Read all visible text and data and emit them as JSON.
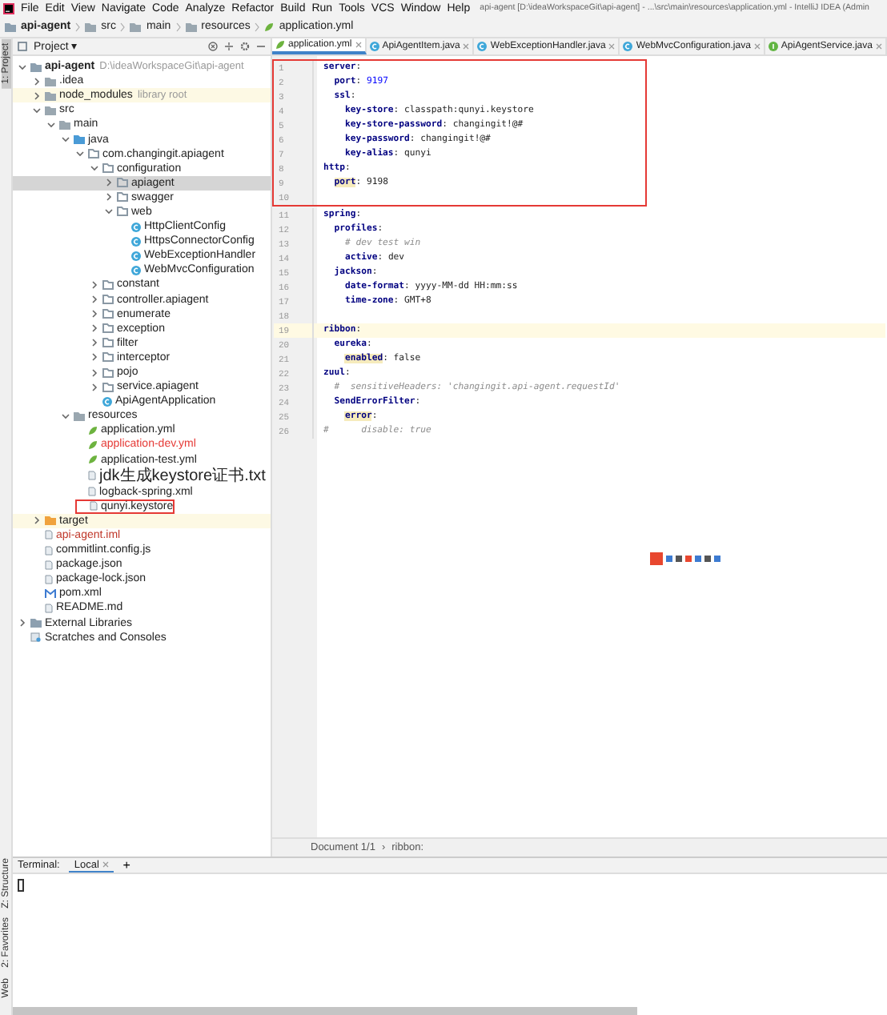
{
  "menu": {
    "items": [
      "File",
      "Edit",
      "View",
      "Navigate",
      "Code",
      "Analyze",
      "Refactor",
      "Build",
      "Run",
      "Tools",
      "VCS",
      "Window",
      "Help"
    ],
    "title": "api-agent [D:\\ideaWorkspaceGit\\api-agent] - ...\\src\\main\\resources\\application.yml - IntelliJ IDEA (Admin"
  },
  "breadcrumbs": [
    {
      "label": "api-agent",
      "kind": "module"
    },
    {
      "label": "src",
      "kind": "folder"
    },
    {
      "label": "main",
      "kind": "folder"
    },
    {
      "label": "resources",
      "kind": "folder"
    },
    {
      "label": "application.yml",
      "kind": "yml"
    }
  ],
  "side_tabs_top": [
    {
      "label": "1: Project",
      "selected": true
    }
  ],
  "side_tabs_bottom": [
    {
      "label": "Z: Structure",
      "selected": false
    },
    {
      "label": "2: Favorites",
      "selected": false
    },
    {
      "label": "Web",
      "selected": false
    }
  ],
  "project_panel": {
    "title": "Project ▾",
    "tree": [
      {
        "label": "api-agent",
        "kind": "module",
        "hint": "D:\\ideaWorkspaceGit\\api-agent",
        "expanded": true,
        "selected": false,
        "children": [
          {
            "label": ".idea",
            "kind": "folder",
            "expanded": false,
            "selected": false
          },
          {
            "label": "node_modules",
            "kind": "folder",
            "hint": "library root",
            "expanded": false,
            "selected": false,
            "shaded": true
          },
          {
            "label": "src",
            "kind": "folder",
            "expanded": true,
            "selected": false,
            "children": [
              {
                "label": "main",
                "kind": "folder",
                "expanded": true,
                "selected": false,
                "children": [
                  {
                    "label": "java",
                    "kind": "source-folder",
                    "expanded": true,
                    "selected": false,
                    "children": [
                      {
                        "label": "com.changingit.apiagent",
                        "kind": "package",
                        "expanded": true,
                        "selected": false,
                        "children": [
                          {
                            "label": "configuration",
                            "kind": "package",
                            "expanded": true,
                            "selected": false,
                            "children": [
                              {
                                "label": "apiagent",
                                "kind": "package",
                                "expanded": false,
                                "selected": true
                              },
                              {
                                "label": "swagger",
                                "kind": "package",
                                "expanded": false,
                                "selected": false
                              },
                              {
                                "label": "web",
                                "kind": "package",
                                "expanded": true,
                                "selected": false,
                                "children": [
                                  {
                                    "label": "HttpClientConfig",
                                    "kind": "class",
                                    "selected": false
                                  },
                                  {
                                    "label": "HttpsConnectorConfig",
                                    "kind": "class",
                                    "selected": false
                                  },
                                  {
                                    "label": "WebExceptionHandler",
                                    "kind": "class",
                                    "selected": false
                                  },
                                  {
                                    "label": "WebMvcConfiguration",
                                    "kind": "class",
                                    "selected": false
                                  }
                                ]
                              }
                            ]
                          },
                          {
                            "label": "constant",
                            "kind": "package",
                            "expanded": false,
                            "selected": false
                          },
                          {
                            "label": "controller.apiagent",
                            "kind": "package",
                            "expanded": false,
                            "selected": false
                          },
                          {
                            "label": "enumerate",
                            "kind": "package",
                            "expanded": false,
                            "selected": false
                          },
                          {
                            "label": "exception",
                            "kind": "package",
                            "expanded": false,
                            "selected": false
                          },
                          {
                            "label": "filter",
                            "kind": "package",
                            "expanded": false,
                            "selected": false
                          },
                          {
                            "label": "interceptor",
                            "kind": "package",
                            "expanded": false,
                            "selected": false
                          },
                          {
                            "label": "pojo",
                            "kind": "package",
                            "expanded": false,
                            "selected": false
                          },
                          {
                            "label": "service.apiagent",
                            "kind": "package",
                            "expanded": false,
                            "selected": false
                          },
                          {
                            "label": "ApiAgentApplication",
                            "kind": "spring-class",
                            "selected": false
                          }
                        ]
                      }
                    ]
                  },
                  {
                    "label": "resources",
                    "kind": "resources-folder",
                    "expanded": true,
                    "selected": false,
                    "children": [
                      {
                        "label": "application.yml",
                        "kind": "yml",
                        "selected": false
                      },
                      {
                        "label": "application-dev.yml",
                        "kind": "yml",
                        "selected": false,
                        "color": "#e53935"
                      },
                      {
                        "label": "application-test.yml",
                        "kind": "yml",
                        "selected": false
                      },
                      {
                        "label": "jdk生成keystore证书.txt",
                        "kind": "text-file",
                        "selected": false
                      },
                      {
                        "label": "logback-spring.xml",
                        "kind": "xml",
                        "selected": false
                      },
                      {
                        "label": "qunyi.keystore",
                        "kind": "keystore",
                        "selected": false,
                        "annotated": true
                      }
                    ]
                  }
                ]
              }
            ]
          },
          {
            "label": "target",
            "kind": "excluded-folder",
            "expanded": false,
            "selected": false,
            "shaded": true
          },
          {
            "label": "api-agent.iml",
            "kind": "iml",
            "selected": false,
            "color": "#c0392b"
          },
          {
            "label": "commitlint.config.js",
            "kind": "js",
            "selected": false
          },
          {
            "label": "package.json",
            "kind": "json",
            "selected": false
          },
          {
            "label": "package-lock.json",
            "kind": "json",
            "selected": false
          },
          {
            "label": "pom.xml",
            "kind": "maven",
            "selected": false
          },
          {
            "label": "README.md",
            "kind": "markdown",
            "selected": false
          }
        ]
      },
      {
        "label": "External Libraries",
        "kind": "libraries",
        "expanded": false,
        "selected": false
      },
      {
        "label": "Scratches and Consoles",
        "kind": "scratches",
        "selected": false
      }
    ]
  },
  "editor": {
    "tabs": [
      {
        "label": "application.yml",
        "kind": "yml",
        "selected": true
      },
      {
        "label": "ApiAgentItem.java",
        "kind": "class",
        "selected": false
      },
      {
        "label": "WebExceptionHandler.java",
        "kind": "class",
        "selected": false
      },
      {
        "label": "WebMvcConfiguration.java",
        "kind": "class",
        "selected": false
      },
      {
        "label": "ApiAgentService.java",
        "kind": "interface",
        "selected": false
      }
    ],
    "code_blocks": [
      {
        "annotated": true,
        "lines": [
          {
            "number": "1",
            "segments": [
              {
                "kind": "key",
                "text": "server"
              },
              {
                "kind": "plain",
                "text": ":"
              }
            ]
          },
          {
            "number": "2",
            "segments": [
              {
                "kind": "key",
                "text": "  port"
              },
              {
                "kind": "plain",
                "text": ": "
              },
              {
                "kind": "number",
                "text": "9197"
              }
            ]
          },
          {
            "number": "3",
            "segments": [
              {
                "kind": "key",
                "text": "  ssl"
              },
              {
                "kind": "plain",
                "text": ":"
              }
            ]
          },
          {
            "number": "4",
            "segments": [
              {
                "kind": "key",
                "text": "    key-store"
              },
              {
                "kind": "plain",
                "text": ": classpath:qunyi.keystore"
              }
            ]
          },
          {
            "number": "5",
            "segments": [
              {
                "kind": "key",
                "text": "    key-store-password"
              },
              {
                "kind": "plain",
                "text": ": changingit!@#"
              }
            ]
          },
          {
            "number": "6",
            "segments": [
              {
                "kind": "key",
                "text": "    key-password"
              },
              {
                "kind": "plain",
                "text": ": changingit!@#"
              }
            ]
          },
          {
            "number": "7",
            "segments": [
              {
                "kind": "key",
                "text": "    key-alias"
              },
              {
                "kind": "plain",
                "text": ": qunyi"
              }
            ]
          },
          {
            "number": "8",
            "segments": [
              {
                "kind": "key",
                "text": "http"
              },
              {
                "kind": "plain",
                "text": ":"
              }
            ]
          },
          {
            "number": "9",
            "segments": [
              {
                "kind": "marked-key",
                "text": "  port"
              },
              {
                "kind": "plain",
                "text": ": 9198"
              }
            ]
          },
          {
            "number": "10"
          }
        ]
      },
      {
        "annotated": false,
        "lines": [
          {
            "number": "11",
            "segments": [
              {
                "kind": "key",
                "text": "spring"
              },
              {
                "kind": "plain",
                "text": ":"
              }
            ]
          },
          {
            "number": "12",
            "segments": [
              {
                "kind": "key",
                "text": "  profiles"
              },
              {
                "kind": "plain",
                "text": ":"
              }
            ]
          },
          {
            "number": "13",
            "segments": [
              {
                "kind": "comment",
                "text": "    # dev test win"
              }
            ]
          },
          {
            "number": "14",
            "segments": [
              {
                "kind": "key",
                "text": "    active"
              },
              {
                "kind": "plain",
                "text": ": dev"
              }
            ]
          },
          {
            "number": "15",
            "segments": [
              {
                "kind": "key",
                "text": "  jackson"
              },
              {
                "kind": "plain",
                "text": ":"
              }
            ]
          },
          {
            "number": "16",
            "segments": [
              {
                "kind": "key",
                "text": "    date-format"
              },
              {
                "kind": "plain",
                "text": ": yyyy-MM-dd HH:mm:ss"
              }
            ]
          },
          {
            "number": "17",
            "segments": [
              {
                "kind": "key",
                "text": "    time-zone"
              },
              {
                "kind": "plain",
                "text": ": GMT+8"
              }
            ]
          },
          {
            "number": "18"
          },
          {
            "number": "19",
            "current": true,
            "segments": [
              {
                "kind": "key",
                "text": "ribbon"
              },
              {
                "kind": "plain",
                "text": ":"
              }
            ]
          },
          {
            "number": "20",
            "segments": [
              {
                "kind": "key",
                "text": "  eureka"
              },
              {
                "kind": "plain",
                "text": ":"
              }
            ]
          },
          {
            "number": "21",
            "segments": [
              {
                "kind": "marked-key",
                "text": "    enabled"
              },
              {
                "kind": "plain",
                "text": ": false"
              }
            ]
          },
          {
            "number": "22",
            "segments": [
              {
                "kind": "key",
                "text": "zuul"
              },
              {
                "kind": "plain",
                "text": ":"
              }
            ]
          },
          {
            "number": "23",
            "segments": [
              {
                "kind": "comment",
                "text": "  #  sensitiveHeaders: 'changingit.api-agent.requestId'"
              }
            ]
          },
          {
            "number": "24",
            "segments": [
              {
                "kind": "key",
                "text": "  SendErrorFilter"
              },
              {
                "kind": "plain",
                "text": ":"
              }
            ]
          },
          {
            "number": "25",
            "segments": [
              {
                "kind": "marked-key",
                "text": "    error"
              },
              {
                "kind": "plain",
                "text": ":"
              }
            ]
          },
          {
            "number": "26",
            "segments": [
              {
                "kind": "comment",
                "text": "#      disable: true"
              }
            ]
          }
        ]
      }
    ],
    "status": [
      "Document 1/1",
      "›",
      "ribbon:"
    ]
  },
  "terminal": {
    "title": "Terminal:",
    "tabs": [
      {
        "label": "Local",
        "selected": true
      }
    ],
    "add": "+"
  }
}
